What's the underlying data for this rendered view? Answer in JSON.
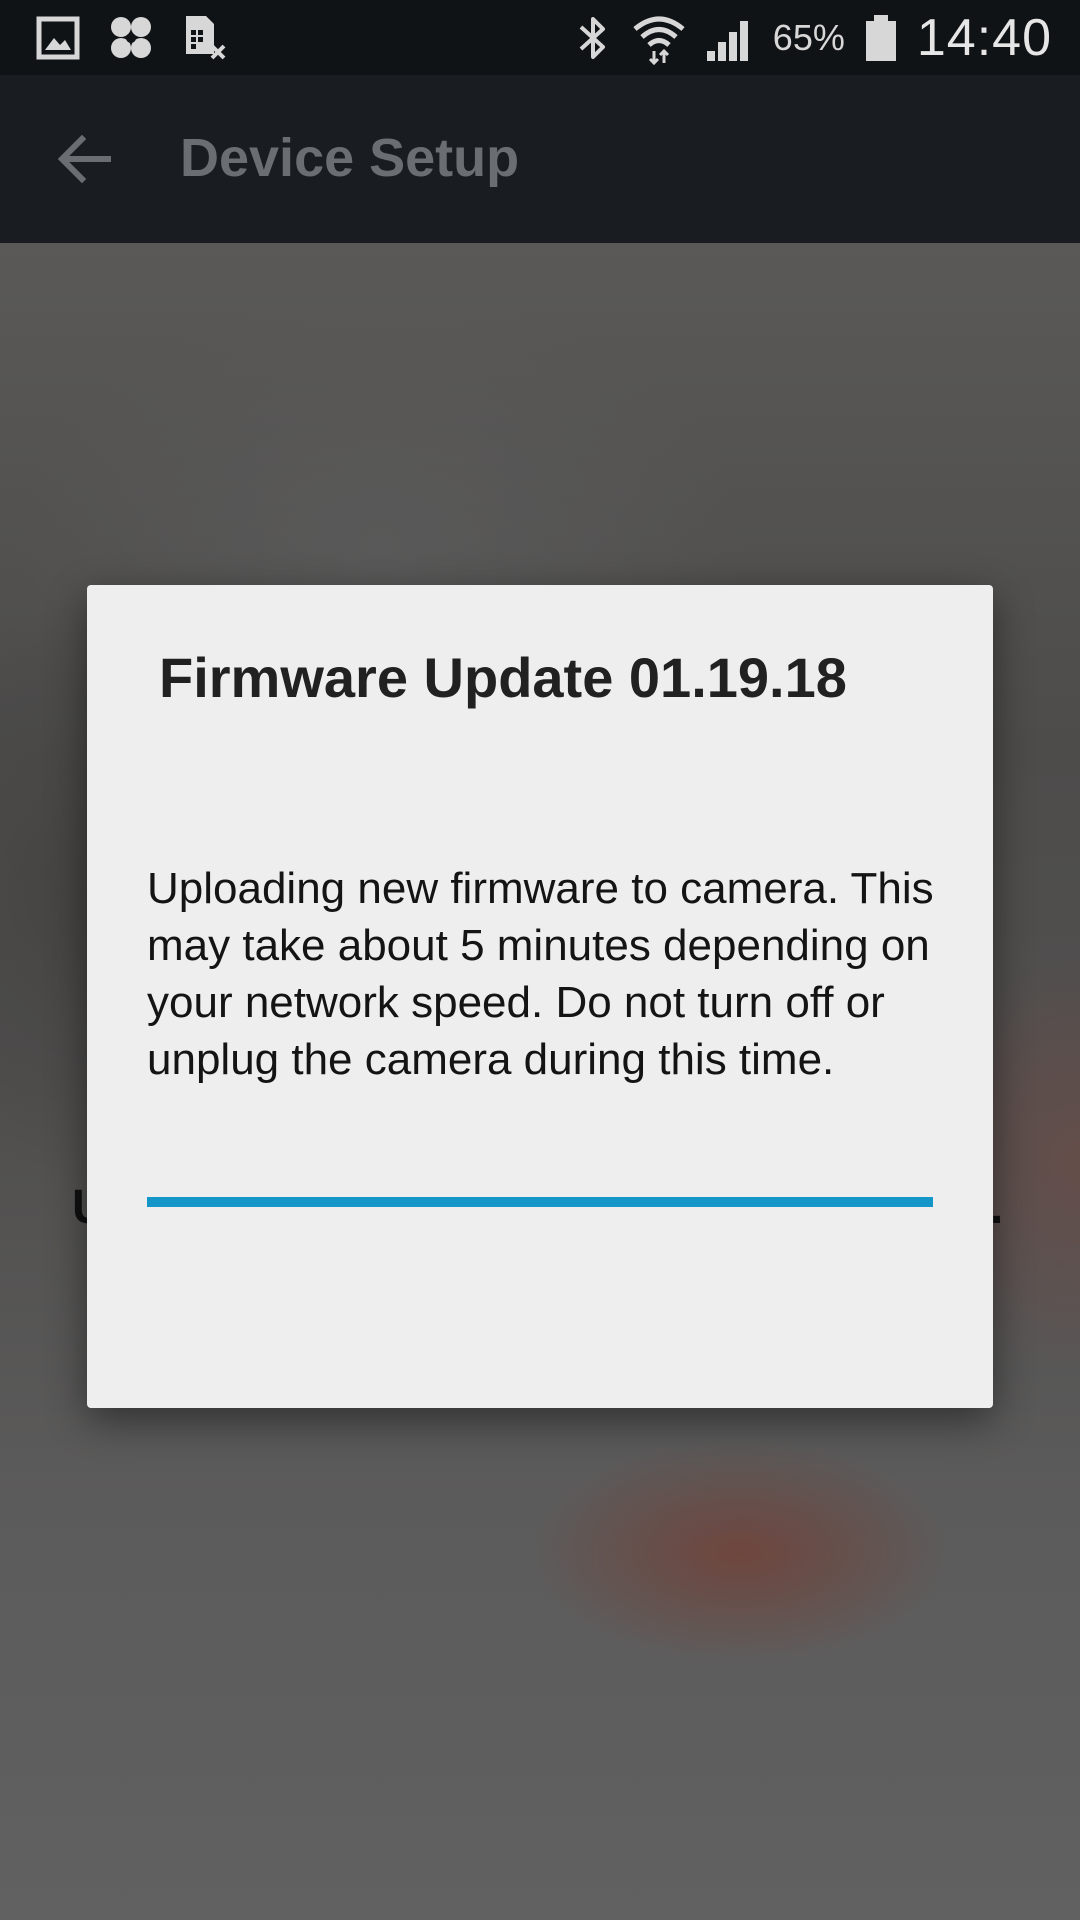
{
  "status_bar": {
    "left_icons": [
      "gallery-icon",
      "pinwheel-icon",
      "sim-error-icon"
    ],
    "right_icons": [
      "bluetooth-icon",
      "wifi-icon",
      "signal-icon",
      "battery-icon"
    ],
    "battery_percent": "65%",
    "time": "14:40"
  },
  "app_bar": {
    "title": "Device Setup",
    "back_icon": "back-arrow-icon"
  },
  "background": {
    "partial_text_left": "U",
    "partial_text_right": "."
  },
  "dialog": {
    "title": "Firmware Update 01.19.18",
    "message": "Uploading new firmware to camera. This may take about 5 minutes depending on your network speed. Do not turn off or unplug the camera during this time.",
    "progress_fraction": 1.0
  },
  "colors": {
    "progress": "#1596c8",
    "dialog_bg": "#eeeeee",
    "app_bar_bg": "#191d21",
    "status_bar_bg": "#101316"
  }
}
